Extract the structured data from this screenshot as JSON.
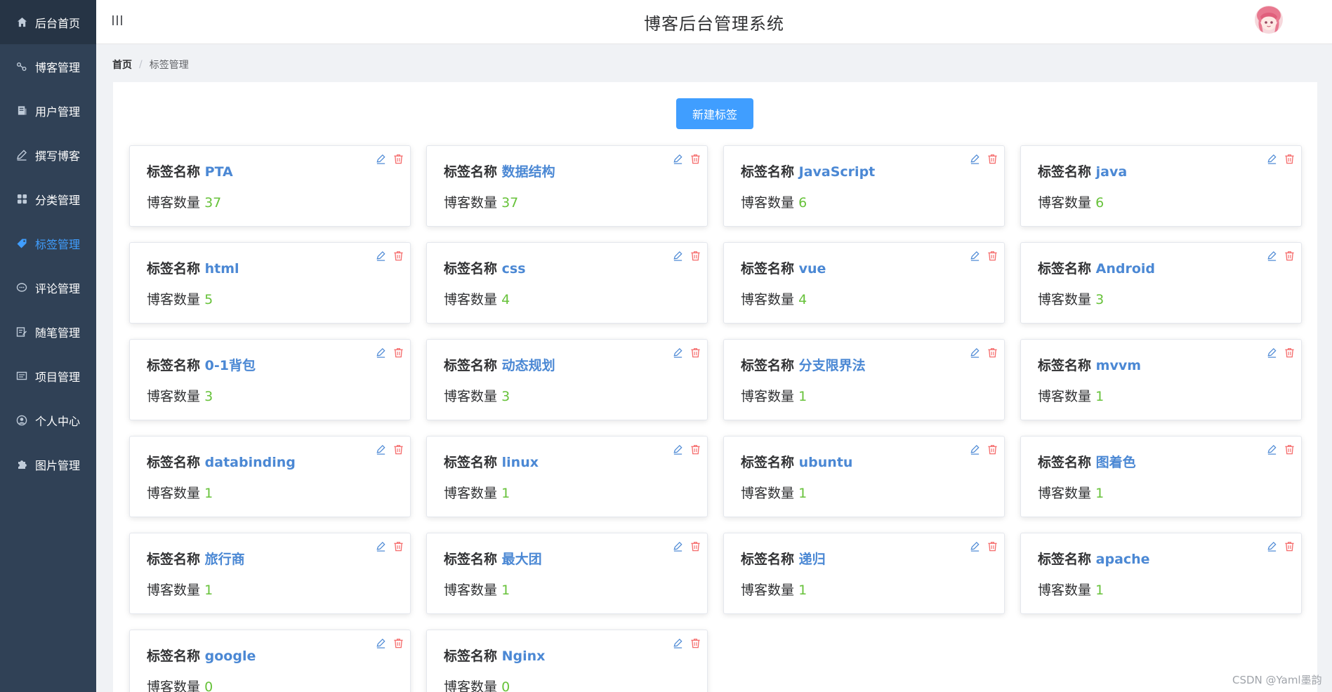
{
  "sidebar": {
    "items": [
      {
        "label": "后台首页",
        "icon": "home-icon"
      },
      {
        "label": "博客管理",
        "icon": "share-icon"
      },
      {
        "label": "用户管理",
        "icon": "document-icon"
      },
      {
        "label": "撰写博客",
        "icon": "pencil-icon"
      },
      {
        "label": "分类管理",
        "icon": "grid-icon"
      },
      {
        "label": "标签管理",
        "icon": "tag-icon",
        "active": true
      },
      {
        "label": "评论管理",
        "icon": "comment-icon"
      },
      {
        "label": "随笔管理",
        "icon": "edit-note-icon"
      },
      {
        "label": "项目管理",
        "icon": "monitor-icon"
      },
      {
        "label": "个人中心",
        "icon": "user-circle-icon"
      },
      {
        "label": "图片管理",
        "icon": "puzzle-icon"
      }
    ]
  },
  "header": {
    "title": "博客后台管理系统"
  },
  "breadcrumb": {
    "home": "首页",
    "separator": "/",
    "current": "标签管理"
  },
  "toolbar": {
    "new_tag_label": "新建标签"
  },
  "card_labels": {
    "name_label": "标签名称",
    "count_label": "博客数量"
  },
  "tags": [
    {
      "name": "PTA",
      "count": "37"
    },
    {
      "name": "数据结构",
      "count": "37"
    },
    {
      "name": "JavaScript",
      "count": "6"
    },
    {
      "name": "java",
      "count": "6"
    },
    {
      "name": "html",
      "count": "5"
    },
    {
      "name": "css",
      "count": "4"
    },
    {
      "name": "vue",
      "count": "4"
    },
    {
      "name": "Android",
      "count": "3"
    },
    {
      "name": "0-1背包",
      "count": "3"
    },
    {
      "name": "动态规划",
      "count": "3"
    },
    {
      "name": "分支限界法",
      "count": "1"
    },
    {
      "name": "mvvm",
      "count": "1"
    },
    {
      "name": "databinding",
      "count": "1"
    },
    {
      "name": "linux",
      "count": "1"
    },
    {
      "name": "ubuntu",
      "count": "1"
    },
    {
      "name": "图着色",
      "count": "1"
    },
    {
      "name": "旅行商",
      "count": "1"
    },
    {
      "name": "最大团",
      "count": "1"
    },
    {
      "name": "递归",
      "count": "1"
    },
    {
      "name": "apache",
      "count": "1"
    },
    {
      "name": "google",
      "count": "0"
    },
    {
      "name": "Nginx",
      "count": "0"
    }
  ],
  "watermark": "CSDN @Yaml墨韵",
  "colors": {
    "sidebar_bg": "#304156",
    "active": "#409eff",
    "tag_name": "#4b88d4",
    "count": "#67c23a",
    "delete": "#f56c6c"
  }
}
